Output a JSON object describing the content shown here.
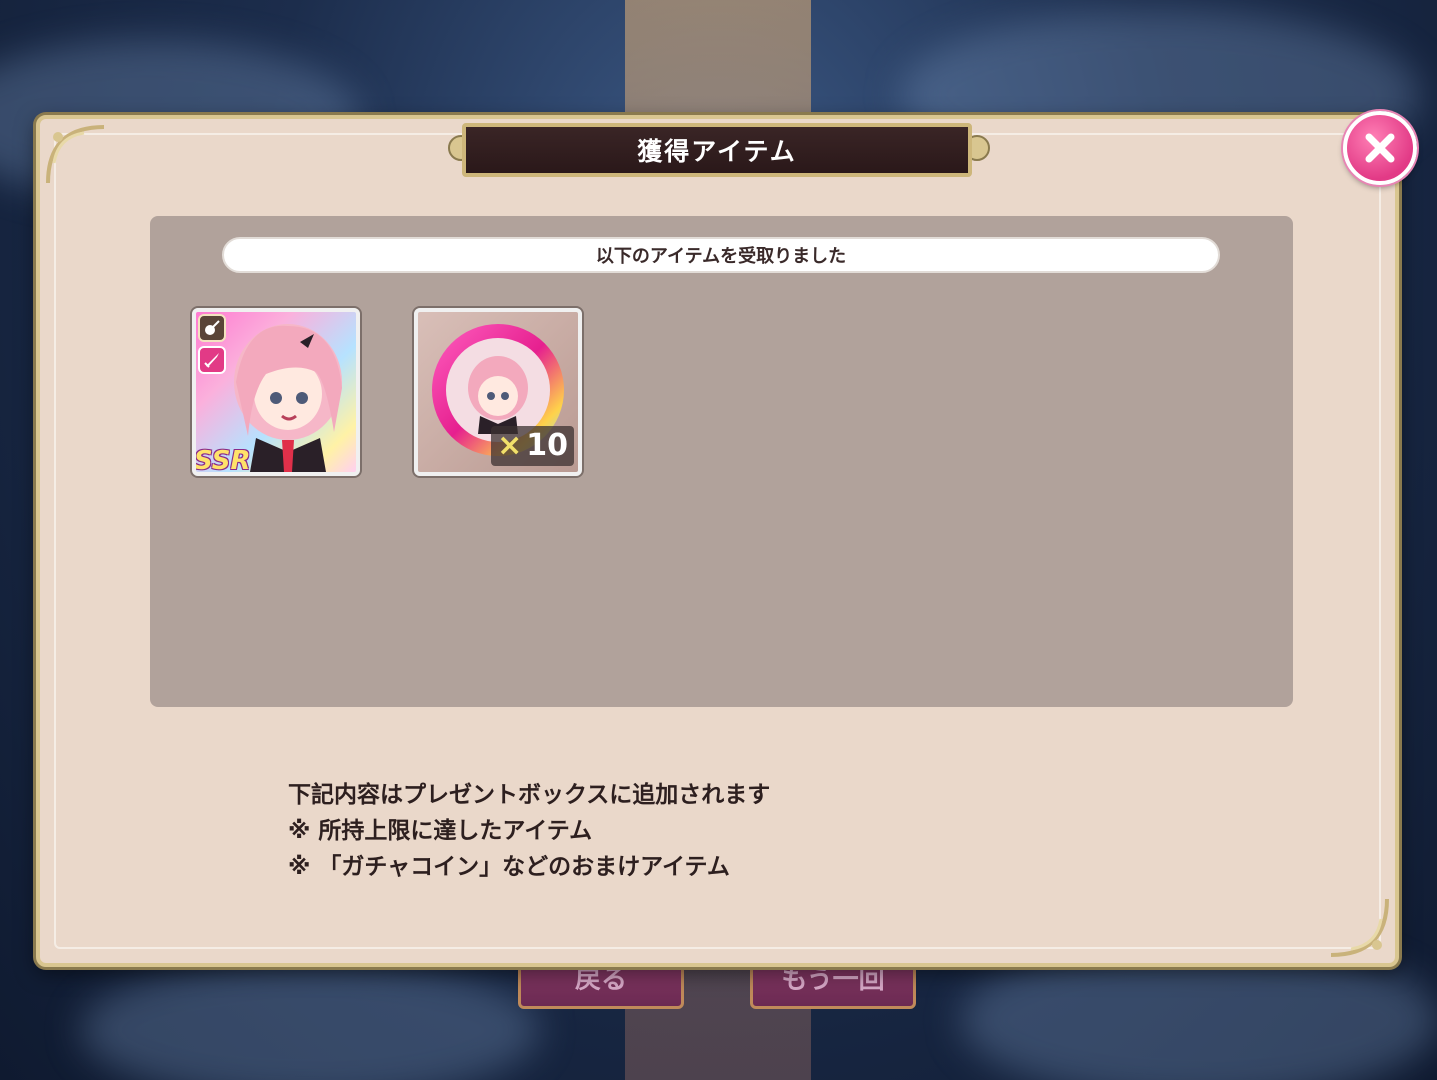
{
  "dialog": {
    "title": "獲得アイテム",
    "received_message": "以下のアイテムを受取りました",
    "close_icon": "close-icon"
  },
  "items": [
    {
      "kind": "character-card",
      "rarity_label": "SSR",
      "icons": [
        "guitar-icon",
        "sword-icon"
      ]
    },
    {
      "kind": "gacha-coin",
      "quantity_prefix": "×",
      "quantity": "10"
    }
  ],
  "notes": [
    "下記内容はプレゼントボックスに追加されます",
    "※ 所持上限に達したアイテム",
    "※ 「ガチャコイン」などのおまけアイテム"
  ],
  "background_buttons": {
    "back_label": "戻る",
    "again_label": "もう一回"
  },
  "colors": {
    "modal_bg": "#ead8ca",
    "panel_bg": "#b1a29b",
    "title_bg": "#2a1819",
    "close_accent": "#e23a86",
    "gold_border": "#d9c690"
  }
}
